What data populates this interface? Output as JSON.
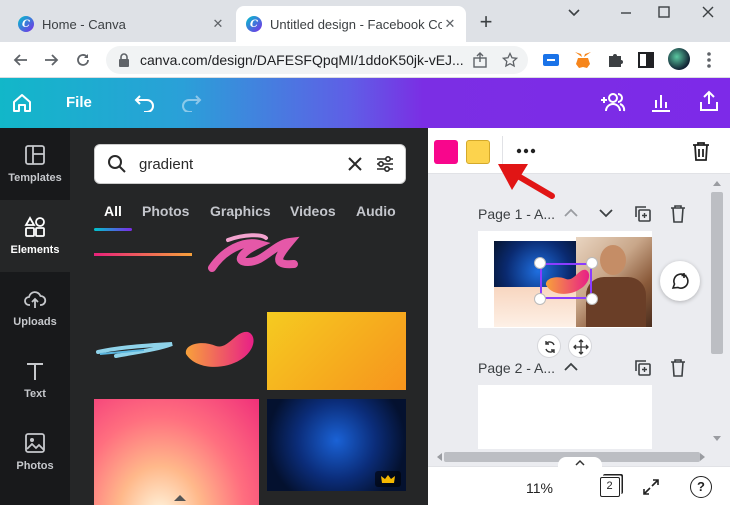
{
  "browser": {
    "tabs": [
      {
        "title": "Home - Canva",
        "active": false
      },
      {
        "title": "Untitled design - Facebook Co",
        "active": true
      }
    ],
    "url": "canva.com/design/DAFESFQpqMI/1ddoK50jk-vEJ...",
    "colors": {
      "tabbar": "#dee1e6",
      "active_tab": "#ffffff"
    }
  },
  "header": {
    "file_label": "File",
    "gradient_colors": [
      "#12b7c9",
      "#7d2ae8"
    ]
  },
  "sidebar": {
    "items": [
      {
        "label": "Templates",
        "icon": "templates-icon"
      },
      {
        "label": "Elements",
        "icon": "elements-icon",
        "active": true
      },
      {
        "label": "Uploads",
        "icon": "upload-cloud-icon"
      },
      {
        "label": "Text",
        "icon": "text-icon"
      },
      {
        "label": "Photos",
        "icon": "photos-icon"
      }
    ]
  },
  "panel": {
    "search_value": "gradient",
    "categories": [
      "All",
      "Photos",
      "Graphics",
      "Videos",
      "Audio"
    ],
    "active_category": "All"
  },
  "canvas": {
    "swatches": [
      "#f8068c",
      "#fcd34d"
    ],
    "pages": [
      {
        "label": "Page 1 - A..."
      },
      {
        "label": "Page 2 - A..."
      }
    ],
    "zoom": "11%",
    "page_count": "2"
  }
}
